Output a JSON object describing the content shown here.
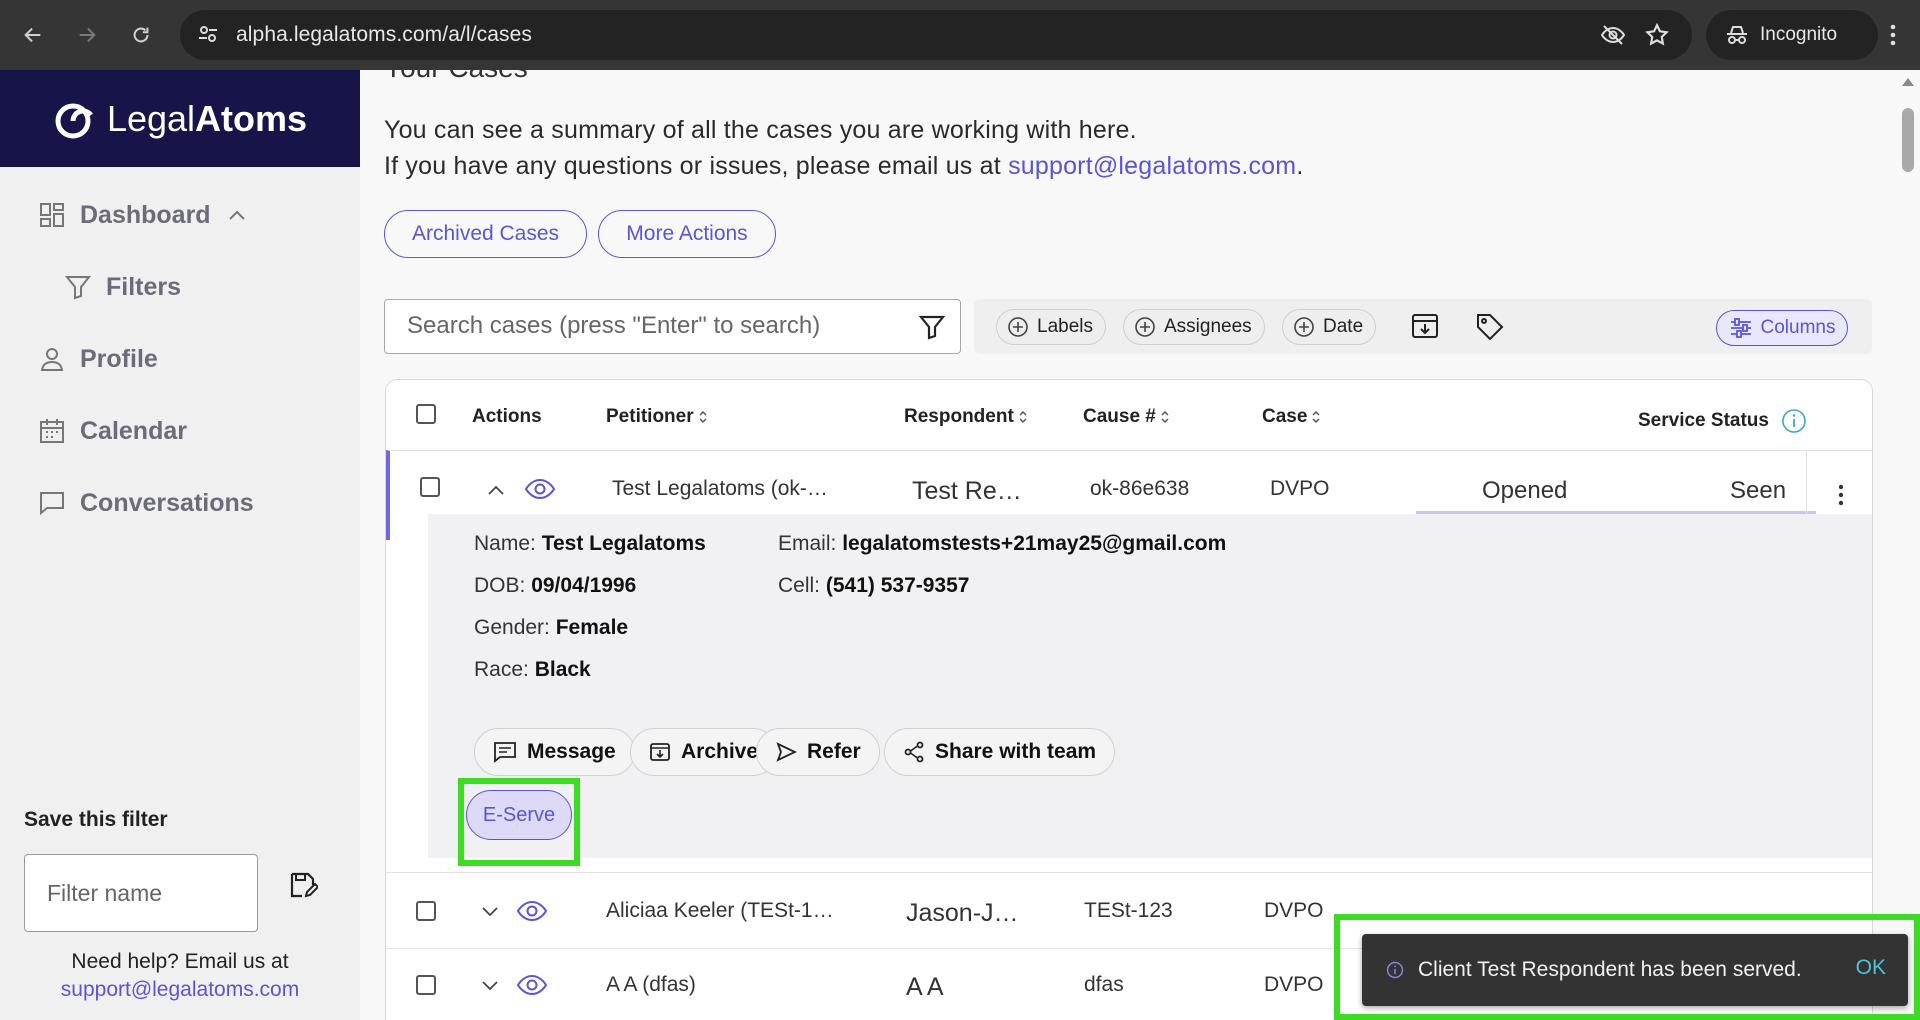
{
  "browser": {
    "url": "alpha.legalatoms.com/a/l/cases",
    "mode_label": "Incognito"
  },
  "brand": {
    "name_light": "Legal",
    "name_bold": "Atoms"
  },
  "sidebar": {
    "items": [
      {
        "label": "Dashboard",
        "icon": "dashboard-icon"
      },
      {
        "label": "Filters",
        "icon": "filter-icon"
      },
      {
        "label": "Profile",
        "icon": "person-icon"
      },
      {
        "label": "Calendar",
        "icon": "calendar-icon"
      },
      {
        "label": "Conversations",
        "icon": "chat-icon"
      }
    ],
    "save_filter_label": "Save this filter",
    "filter_placeholder": "Filter name",
    "help_text": "Need help? Email us at",
    "help_email": "support@legalatoms.com"
  },
  "main": {
    "title_partial": "Your Cases",
    "desc_line1": "You can see a summary of all the cases you are working with here.",
    "desc_line2_prefix": "If you have any questions or issues, please email us at",
    "desc_email": "support@legalatoms.com",
    "desc_line2_suffix": ".",
    "archived_cases_label": "Archived Cases",
    "more_actions_label": "More Actions",
    "search_placeholder": "Search cases (press \"Enter\" to search)",
    "chips": [
      "Labels",
      "Assignees",
      "Date"
    ],
    "columns_label": "Columns"
  },
  "table": {
    "headers": [
      "Actions",
      "Petitioner",
      "Respondent",
      "Cause #",
      "Case",
      "Service Status"
    ],
    "rows": [
      {
        "petitioner": "Test Legalatoms (ok-…",
        "respondent": "Test Re…",
        "cause": "ok-86e638",
        "case": "DVPO",
        "status1": "Opened",
        "status2": "Seen"
      },
      {
        "petitioner": "Aliciaa Keeler (TESt-1…",
        "respondent": "Jason-J…",
        "cause": "TESt-123",
        "case": "DVPO"
      },
      {
        "petitioner": "A A (dfas)",
        "respondent": "A A",
        "cause": "dfas",
        "case": "DVPO"
      }
    ],
    "expanded": {
      "name_label": "Name:",
      "name": "Test Legalatoms",
      "dob_label": "DOB:",
      "dob": "09/04/1996",
      "gender_label": "Gender:",
      "gender": "Female",
      "race_label": "Race:",
      "race": "Black",
      "email_label": "Email:",
      "email": "legalatomstests+21may25@gmail.com",
      "cell_label": "Cell:",
      "cell": "(541) 537-9357",
      "actions": [
        "Message",
        "Archive",
        "Refer",
        "Share with team"
      ],
      "eserve_label": "E-Serve"
    }
  },
  "toast": {
    "message": "Client Test Respondent has been served.",
    "ok_label": "OK"
  },
  "colors": {
    "accent": "#5a55d8",
    "brand_bg": "#161449",
    "highlight": "#3bdc22"
  }
}
